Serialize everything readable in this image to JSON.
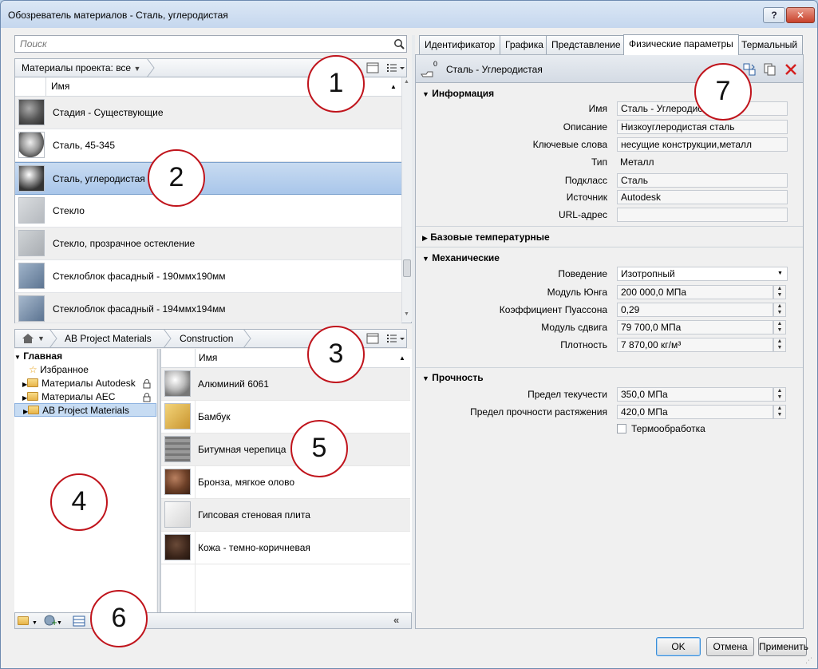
{
  "window": {
    "title": "Обозреватель материалов - Сталь, углеродистая",
    "help_label": "?",
    "close_label": "✕"
  },
  "search": {
    "placeholder": "Поиск"
  },
  "project_panel": {
    "breadcrumb": "Материалы проекта: все",
    "column_header": "Имя",
    "rows": [
      {
        "label": "Стадия - Существующие"
      },
      {
        "label": "Сталь, 45-345"
      },
      {
        "label": "Сталь, углеродистая",
        "selected": true
      },
      {
        "label": "Стекло"
      },
      {
        "label": "Стекло, прозрачное остекление"
      },
      {
        "label": "Стеклоблок фасадный - 190ммх190мм"
      },
      {
        "label": "Стеклоблок фасадный - 194ммх194мм"
      }
    ]
  },
  "library_panel": {
    "breadcrumb": [
      "AB Project Materials",
      "Construction"
    ],
    "tree": {
      "root": "Главная",
      "items": [
        "Избранное",
        "Материалы Autodesk",
        "Материалы AEC",
        "AB Project Materials"
      ]
    },
    "column_header": "Имя",
    "rows": [
      {
        "label": "Алюминий 6061"
      },
      {
        "label": "Бамбук"
      },
      {
        "label": "Битумная черепица"
      },
      {
        "label": "Бронза, мягкое олово"
      },
      {
        "label": "Гипсовая стеновая плита"
      },
      {
        "label": "Кожа - темно-коричневая"
      }
    ]
  },
  "tabs": [
    "Идентификатор",
    "Графика",
    "Представление",
    "Физические параметры",
    "Термальный"
  ],
  "active_tab": "Физические параметры",
  "asset": {
    "count": "0",
    "name": "Сталь - Углеродистая"
  },
  "info": {
    "title": "Информация",
    "name_label": "Имя",
    "name_value": "Сталь - Углеродистая",
    "desc_label": "Описание",
    "desc_value": "Низкоуглеродистая сталь",
    "keywords_label": "Ключевые слова",
    "keywords_value": "несущие конструкции,металл",
    "type_label": "Тип",
    "type_value": "Металл",
    "subclass_label": "Подкласс",
    "subclass_value": "Сталь",
    "source_label": "Источник",
    "source_value": "Autodesk",
    "url_label": "URL-адрес",
    "url_value": ""
  },
  "base_temp": {
    "title": "Базовые температурные"
  },
  "mechanical": {
    "title": "Механические",
    "behavior_label": "Поведение",
    "behavior_value": "Изотропный",
    "young_label": "Модуль Юнга",
    "young_value": "200 000,0 МПа",
    "poisson_label": "Коэффициент Пуассона",
    "poisson_value": "0,29",
    "shear_label": "Модуль сдвига",
    "shear_value": "79 700,0 МПа",
    "density_label": "Плотность",
    "density_value": "7 870,00 кг/м³"
  },
  "strength": {
    "title": "Прочность",
    "yield_label": "Предел текучести",
    "yield_value": "350,0 МПа",
    "tensile_label": "Предел прочности растяжения",
    "tensile_value": "420,0 МПа",
    "heat_label": "Термообработка"
  },
  "buttons": {
    "ok": "OK",
    "cancel": "Отмена",
    "apply": "Применить"
  },
  "callouts": [
    "1",
    "2",
    "3",
    "4",
    "5",
    "6",
    "7"
  ],
  "colors": {
    "accent": "#3c7fc4",
    "selection": "#b6cfee",
    "callout_border": "#c0141c",
    "delete": "#d42020"
  }
}
